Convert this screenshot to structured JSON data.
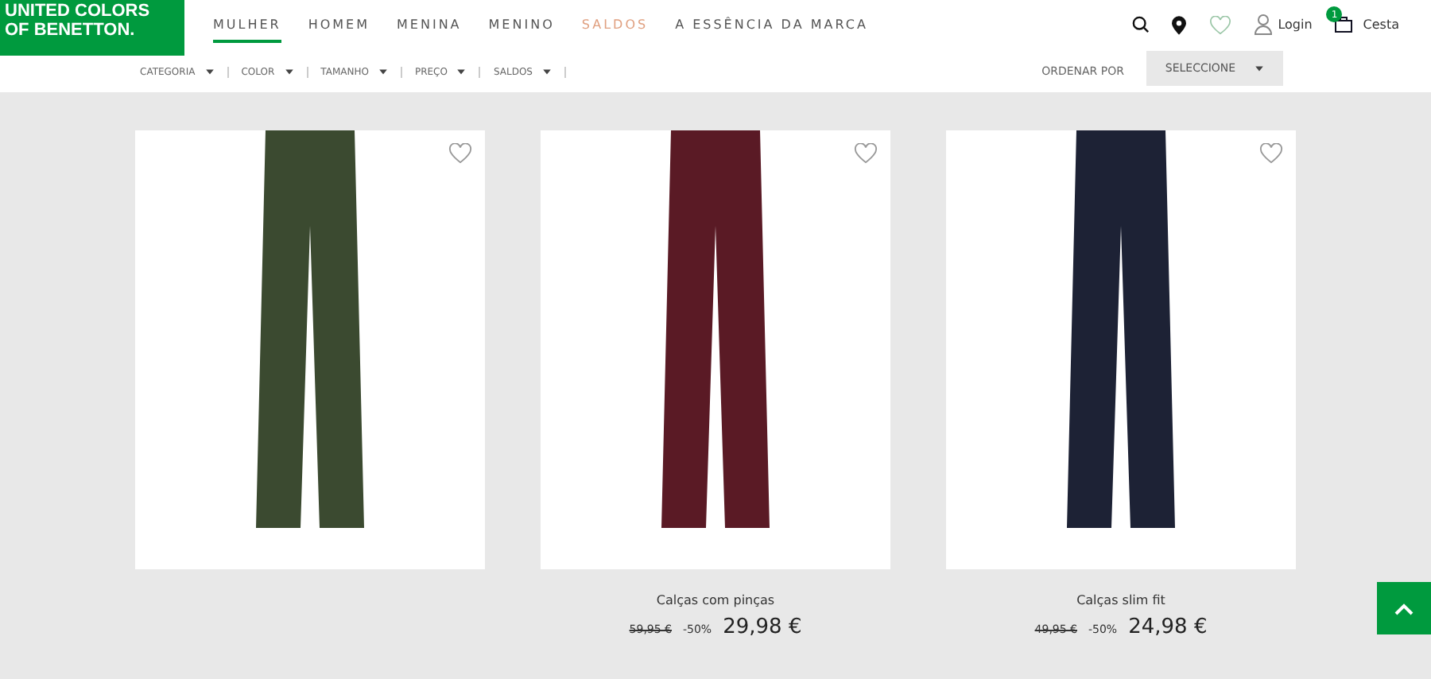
{
  "logo": {
    "lines": [
      "UNITED COLORS",
      "OF BENETTON."
    ]
  },
  "nav": [
    {
      "label": "MULHER",
      "selected": true,
      "sale": false
    },
    {
      "label": "HOMEM",
      "selected": false,
      "sale": false
    },
    {
      "label": "MENINA",
      "selected": false,
      "sale": false
    },
    {
      "label": "MENINO",
      "selected": false,
      "sale": false
    },
    {
      "label": "SALDOS",
      "selected": false,
      "sale": true
    },
    {
      "label": "A ESSÊNCIA DA MARCA",
      "selected": false,
      "sale": false
    }
  ],
  "account": {
    "login": "Login",
    "cart_count": "1",
    "cart": "Cesta"
  },
  "filters": [
    "CATEGORIA",
    "COLOR",
    "TAMANHO",
    "PREÇO",
    "SALDOS"
  ],
  "sort": {
    "label": "ORDENAR POR",
    "value": "SELECCIONE"
  },
  "products": [
    {
      "color": "#3b4a30"
    },
    {
      "color": "#5a1a25",
      "name": "Calças com pinças",
      "old_price": "59,95 €",
      "discount": "-50%",
      "price": "29,98 €"
    },
    {
      "color": "#1d2235",
      "name": "Calças slim fit",
      "old_price": "49,95 €",
      "discount": "-50%",
      "price": "24,98 €"
    }
  ],
  "back_to_top": true
}
